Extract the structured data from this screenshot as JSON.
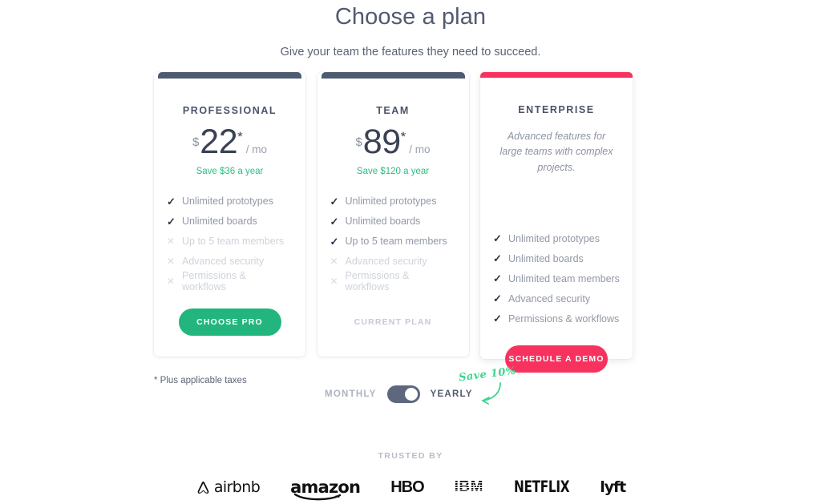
{
  "header": {
    "title": "Choose a plan",
    "subtitle": "Give your team the features they need to succeed."
  },
  "colors": {
    "accent_green": "#22b57e",
    "accent_pink": "#f8325e",
    "card_bar_dark": "#4e5a70",
    "save_green": "#2cbd80",
    "note_green": "#3fd48f"
  },
  "plans": [
    {
      "name": "PROFESSIONAL",
      "currency": "$",
      "amount": "22",
      "star": "*",
      "period": "/ mo",
      "save": "Save $36 a year",
      "description": "",
      "features": [
        {
          "label": "Unlimited prototypes",
          "included": true,
          "icon": "check-icon"
        },
        {
          "label": "Unlimited boards",
          "included": true,
          "icon": "check-icon"
        },
        {
          "label": "Up to 5 team members",
          "included": false,
          "icon": "cross-icon"
        },
        {
          "label": "Advanced security",
          "included": false,
          "icon": "cross-icon"
        },
        {
          "label": "Permissions & workflows",
          "included": false,
          "icon": "cross-icon"
        }
      ],
      "cta_label": "CHOOSE PRO",
      "cta_style": "green",
      "featured": false
    },
    {
      "name": "TEAM",
      "currency": "$",
      "amount": "89",
      "star": "*",
      "period": "/ mo",
      "save": "Save $120 a year",
      "description": "",
      "features": [
        {
          "label": "Unlimited prototypes",
          "included": true,
          "icon": "check-icon"
        },
        {
          "label": "Unlimited boards",
          "included": true,
          "icon": "check-icon"
        },
        {
          "label": "Up to 5 team members",
          "included": true,
          "icon": "check-icon"
        },
        {
          "label": "Advanced security",
          "included": false,
          "icon": "cross-icon"
        },
        {
          "label": "Permissions & workflows",
          "included": false,
          "icon": "cross-icon"
        }
      ],
      "cta_label": "CURRENT PLAN",
      "cta_style": "ghost",
      "featured": false
    },
    {
      "name": "ENTERPRISE",
      "currency": "",
      "amount": "",
      "star": "",
      "period": "",
      "save": "",
      "description": "Advanced features for large teams with complex projects.",
      "features": [
        {
          "label": "Unlimited prototypes",
          "included": true,
          "icon": "check-icon"
        },
        {
          "label": "Unlimited boards",
          "included": true,
          "icon": "check-icon"
        },
        {
          "label": "Unlimited team members",
          "included": true,
          "icon": "check-icon"
        },
        {
          "label": "Advanced security",
          "included": true,
          "icon": "check-icon"
        },
        {
          "label": "Permissions & workflows",
          "included": true,
          "icon": "check-icon"
        }
      ],
      "cta_label": "SCHEDULE A DEMO",
      "cta_style": "pink",
      "featured": true
    }
  ],
  "footnote": "* Plus applicable taxes",
  "billing_toggle": {
    "left_label": "MONTHLY",
    "right_label": "YEARLY",
    "selected": "YEARLY",
    "note": "Save 10%"
  },
  "trusted": {
    "title": "TRUSTED BY",
    "logos": [
      {
        "name": "airbnb",
        "text": "airbnb"
      },
      {
        "name": "amazon",
        "text": "amazon"
      },
      {
        "name": "hbo",
        "text": "HBO"
      },
      {
        "name": "ibm",
        "text": "IBM"
      },
      {
        "name": "netflix",
        "text": "NETFLIX"
      },
      {
        "name": "lyft",
        "text": "lyft"
      }
    ]
  }
}
